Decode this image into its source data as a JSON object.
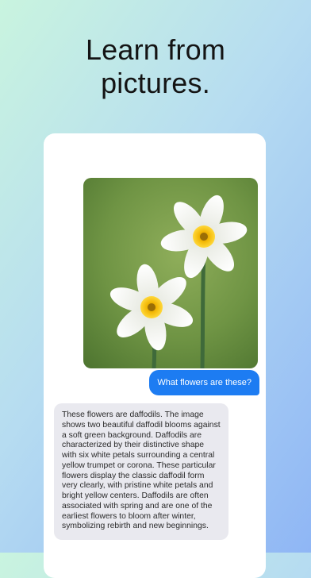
{
  "headline": {
    "line1": "Learn from",
    "line2": "pictures."
  },
  "chat": {
    "image_subject": "two white daffodils with yellow centers on a soft green background",
    "user_message": "What flowers are these?",
    "assistant_message": "These flowers are daffodils. The image shows two beautiful daffodil blooms against a soft green background. Daffodils are characterized by their distinctive shape with six white petals surrounding a central yellow trumpet or corona. These particular flowers display the classic daffodil form very clearly, with pristine white petals and bright yellow centers. Daffodils are often associated with spring and are one of the earliest flowers to bloom after winter, symbolizing rebirth and new beginnings."
  },
  "colors": {
    "user_bubble": "#1d7cf2",
    "assistant_bubble": "#e9e9ef",
    "card": "#ffffff"
  }
}
